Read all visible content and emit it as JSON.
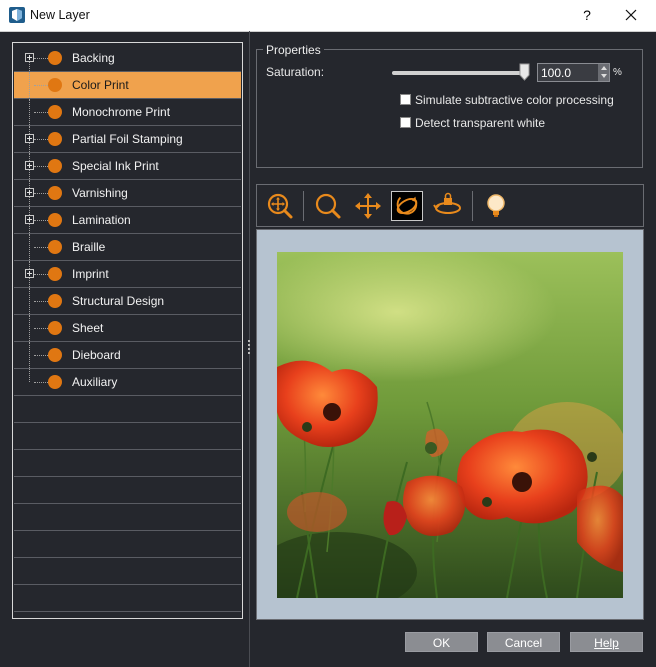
{
  "window": {
    "title": "New Layer",
    "help_label": "?"
  },
  "tree": {
    "items": [
      {
        "label": "Backing",
        "expandable": true,
        "selected": false
      },
      {
        "label": "Color Print",
        "expandable": false,
        "selected": true
      },
      {
        "label": "Monochrome Print",
        "expandable": false,
        "selected": false
      },
      {
        "label": "Partial Foil Stamping",
        "expandable": true,
        "selected": false
      },
      {
        "label": "Special Ink Print",
        "expandable": true,
        "selected": false
      },
      {
        "label": "Varnishing",
        "expandable": true,
        "selected": false
      },
      {
        "label": "Lamination",
        "expandable": true,
        "selected": false
      },
      {
        "label": "Braille",
        "expandable": false,
        "selected": false
      },
      {
        "label": "Imprint",
        "expandable": true,
        "selected": false
      },
      {
        "label": "Structural Design",
        "expandable": false,
        "selected": false
      },
      {
        "label": "Sheet",
        "expandable": false,
        "selected": false
      },
      {
        "label": "Dieboard",
        "expandable": false,
        "selected": false
      },
      {
        "label": "Auxiliary",
        "expandable": false,
        "selected": false
      }
    ]
  },
  "properties": {
    "legend": "Properties",
    "saturation_label": "Saturation:",
    "saturation_value": "100.0",
    "saturation_fraction": 1.0,
    "unit": "%",
    "simulate_label": "Simulate subtractive color processing",
    "simulate_checked": false,
    "detect_label": "Detect transparent white",
    "detect_checked": false
  },
  "toolbar": {
    "tools": [
      "zoom-fit-icon",
      "zoom-icon",
      "pan-icon",
      "rotate-3d-icon",
      "rotate-lock-icon",
      "light-bulb-icon"
    ],
    "active_tool": "rotate-3d-icon"
  },
  "colors": {
    "accent": "#f0a24d",
    "dot": "#e07712",
    "background": "#25272d",
    "preview_bg": "#b6c3d0"
  },
  "buttons": {
    "ok": "OK",
    "cancel": "Cancel",
    "help": "Help"
  }
}
